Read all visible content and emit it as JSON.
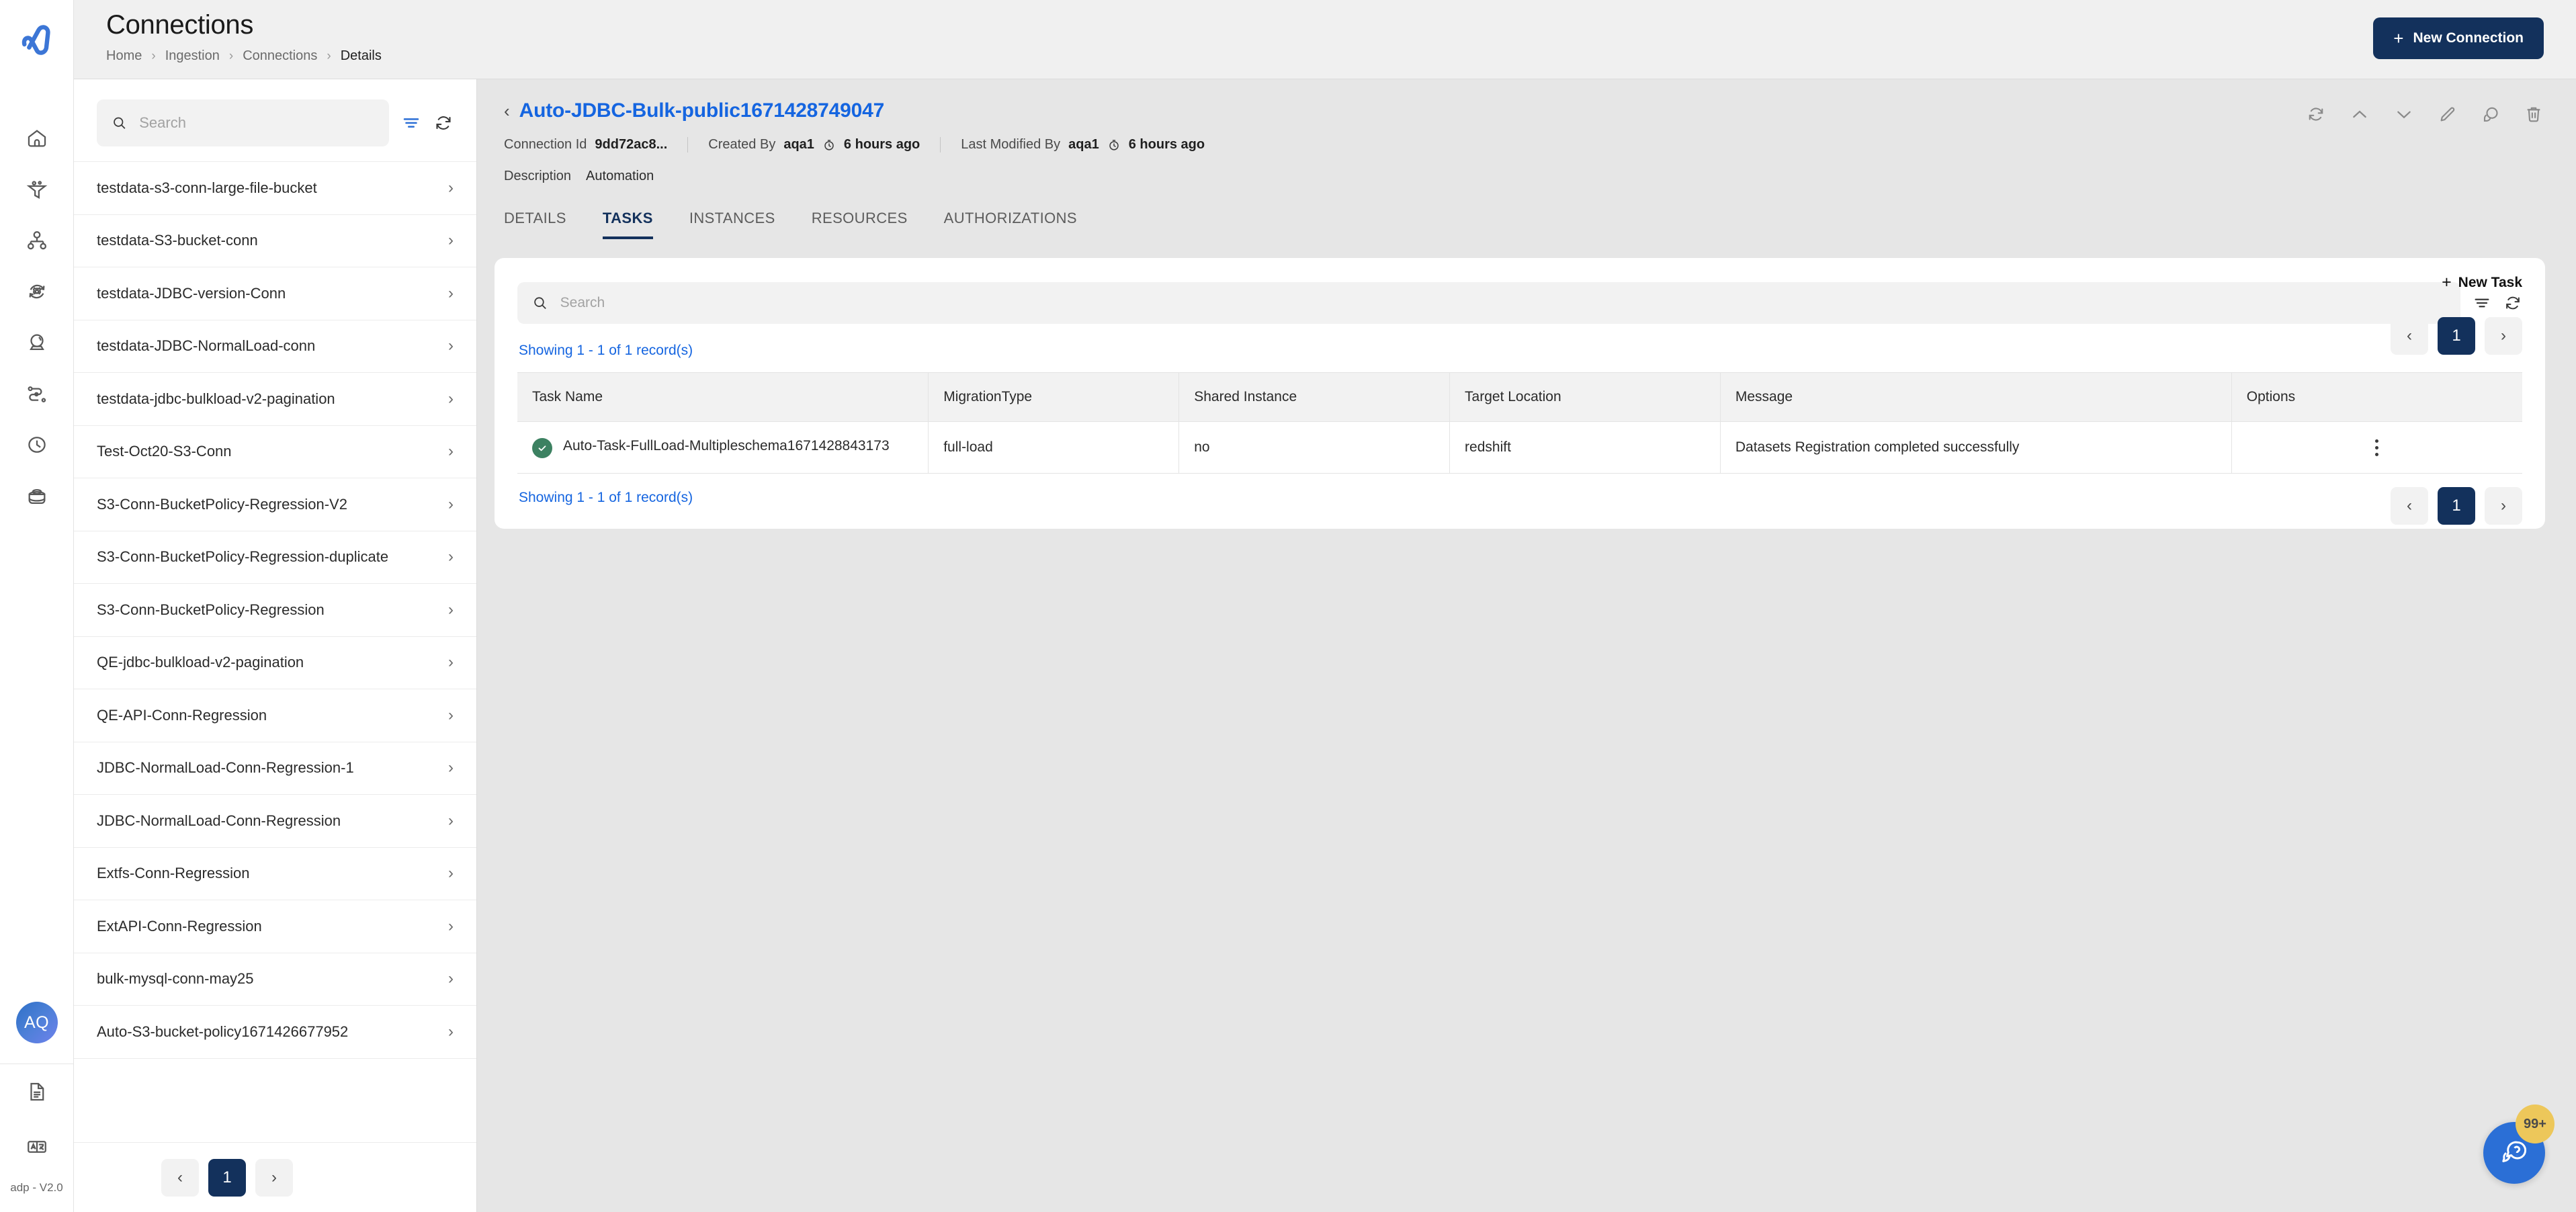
{
  "app": {
    "logo_name": "ascend-logo",
    "version_label": "adp - V2.0",
    "avatar_initials": "AQ"
  },
  "rail": {
    "items": [
      {
        "name": "home-icon",
        "label": "Home"
      },
      {
        "name": "funnel-icon",
        "label": "Ingestion"
      },
      {
        "name": "hierarchy-icon",
        "label": "Hierarchy"
      },
      {
        "name": "gear-refresh-icon",
        "label": "Processing"
      },
      {
        "name": "crystal-ball-icon",
        "label": "Insights"
      },
      {
        "name": "workflow-icon",
        "label": "Workflows"
      },
      {
        "name": "clock-icon",
        "label": "Scheduler"
      },
      {
        "name": "briefcase-icon",
        "label": "Catalog"
      }
    ],
    "bottom_items": [
      {
        "name": "document-icon",
        "label": "Docs"
      },
      {
        "name": "translate-icon",
        "label": "Language"
      }
    ]
  },
  "header": {
    "title": "Connections",
    "breadcrumbs": [
      "Home",
      "Ingestion",
      "Connections",
      "Details"
    ],
    "new_connection_label": "New Connection",
    "plus": "+"
  },
  "list_panel": {
    "search_placeholder": "Search",
    "search_value": "",
    "items": [
      "testdata-s3-conn-large-file-bucket",
      "testdata-S3-bucket-conn",
      "testdata-JDBC-version-Conn",
      "testdata-JDBC-NormalLoad-conn",
      "testdata-jdbc-bulkload-v2-pagination",
      "Test-Oct20-S3-Conn",
      "S3-Conn-BucketPolicy-Regression-V2",
      "S3-Conn-BucketPolicy-Regression-duplicate",
      "S3-Conn-BucketPolicy-Regression",
      "QE-jdbc-bulkload-v2-pagination",
      "QE-API-Conn-Regression",
      "JDBC-NormalLoad-Conn-Regression-1",
      "JDBC-NormalLoad-Conn-Regression",
      "Extfs-Conn-Regression",
      "ExtAPI-Conn-Regression",
      "bulk-mysql-conn-may25",
      "Auto-S3-bucket-policy1671426677952"
    ],
    "pagination": {
      "prev": "‹",
      "page": "1",
      "next": "›"
    }
  },
  "detail": {
    "title": "Auto-JDBC-Bulk-public1671428749047",
    "back": "‹",
    "meta": [
      {
        "label": "Connection Id",
        "value": "9dd72ac8...",
        "has_clock": false
      },
      {
        "label": "Created By",
        "value": "aqa1",
        "has_clock": true,
        "time": "6 hours ago"
      },
      {
        "label": "Last Modified By",
        "value": "aqa1",
        "has_clock": true,
        "time": "6 hours ago"
      }
    ],
    "description_label": "Description",
    "description_value": "Automation",
    "actions": [
      {
        "name": "refresh-icon"
      },
      {
        "name": "chevron-up-icon"
      },
      {
        "name": "chevron-down-icon"
      },
      {
        "name": "edit-pencil-icon"
      },
      {
        "name": "duplicate-icon"
      },
      {
        "name": "delete-trash-icon"
      }
    ],
    "tabs": [
      {
        "label": "DETAILS",
        "active": false
      },
      {
        "label": "TASKS",
        "active": true
      },
      {
        "label": "INSTANCES",
        "active": false
      },
      {
        "label": "RESOURCES",
        "active": false
      },
      {
        "label": "AUTHORIZATIONS",
        "active": false
      }
    ]
  },
  "tasks_panel": {
    "search_placeholder": "Search",
    "search_value": "",
    "new_task_label": "New Task",
    "plus": "+",
    "showing_top": "Showing 1 - 1 of 1 record(s)",
    "showing_bottom": "Showing 1 - 1 of 1 record(s)",
    "pagination": {
      "prev": "‹",
      "page": "1",
      "next": "›"
    },
    "columns": [
      "Task Name",
      "MigrationType",
      "Shared Instance",
      "Target Location",
      "Message",
      "Options"
    ],
    "rows": [
      {
        "status": "success",
        "task_name": "Auto-Task-FullLoad-Multipleschema1671428843173",
        "migration_type": "full-load",
        "shared_instance": "no",
        "target_location": "redshift",
        "message": "Datasets Registration completed successfully",
        "options": "kebab-menu"
      }
    ]
  },
  "chat": {
    "badge": "99+",
    "icon": "chat-help-icon"
  },
  "colors": {
    "brand_blue": "#2b6fd6",
    "navy": "#13315c",
    "link_blue": "#1565e0",
    "success_green": "#3c8161",
    "badge_yellow": "#edc75a",
    "page_bg": "#e6e6e6"
  }
}
